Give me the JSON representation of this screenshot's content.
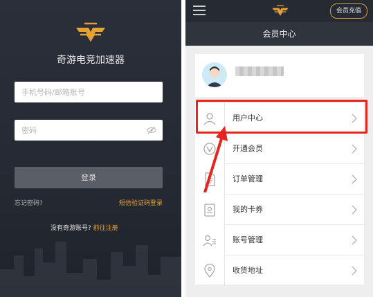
{
  "login": {
    "app_name": "奇游电竞加速器",
    "phone_placeholder": "手机号码/邮箱账号",
    "password_placeholder": "密码",
    "login_button": "登录",
    "forgot_password": "忘记密码?",
    "sms_login": "短信验证码登录",
    "no_account": "没有奇游账号?",
    "go_register": "前往注册"
  },
  "member": {
    "recharge_button": "会员充值",
    "title": "会员中心",
    "menu": [
      {
        "label": "用户中心",
        "icon": "user-icon"
      },
      {
        "label": "开通会员",
        "icon": "vip-icon"
      },
      {
        "label": "订单管理",
        "icon": "document-icon"
      },
      {
        "label": "我的卡券",
        "icon": "coupon-icon"
      },
      {
        "label": "账号管理",
        "icon": "account-manage-icon"
      },
      {
        "label": "收货地址",
        "icon": "location-pin-icon"
      }
    ]
  },
  "colors": {
    "accent": "#e4a233",
    "highlight": "#e8231f",
    "dark_bg": "#262a33"
  }
}
